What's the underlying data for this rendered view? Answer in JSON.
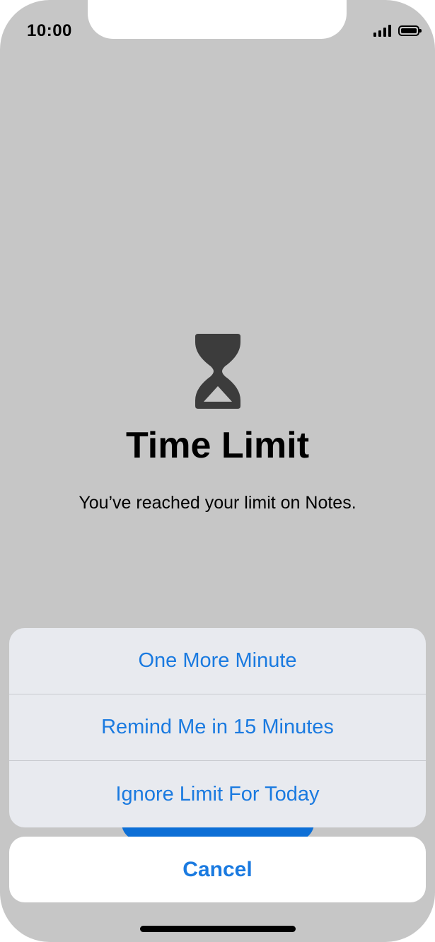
{
  "status_bar": {
    "time": "10:00",
    "signal_icon": "cellular-signal-icon",
    "battery_icon": "battery-icon"
  },
  "screen": {
    "icon": "hourglass-icon",
    "title": "Time Limit",
    "message": "You’ve reached your limit on Notes."
  },
  "action_sheet": {
    "actions": [
      {
        "label": "One More Minute"
      },
      {
        "label": "Remind Me in 15 Minutes"
      },
      {
        "label": "Ignore Limit For Today"
      }
    ],
    "cancel_label": "Cancel"
  },
  "colors": {
    "background": "#c6c6c6",
    "accent": "#1a7ae0",
    "sheet": "#e8eaef",
    "icon": "#3c3c3c"
  }
}
